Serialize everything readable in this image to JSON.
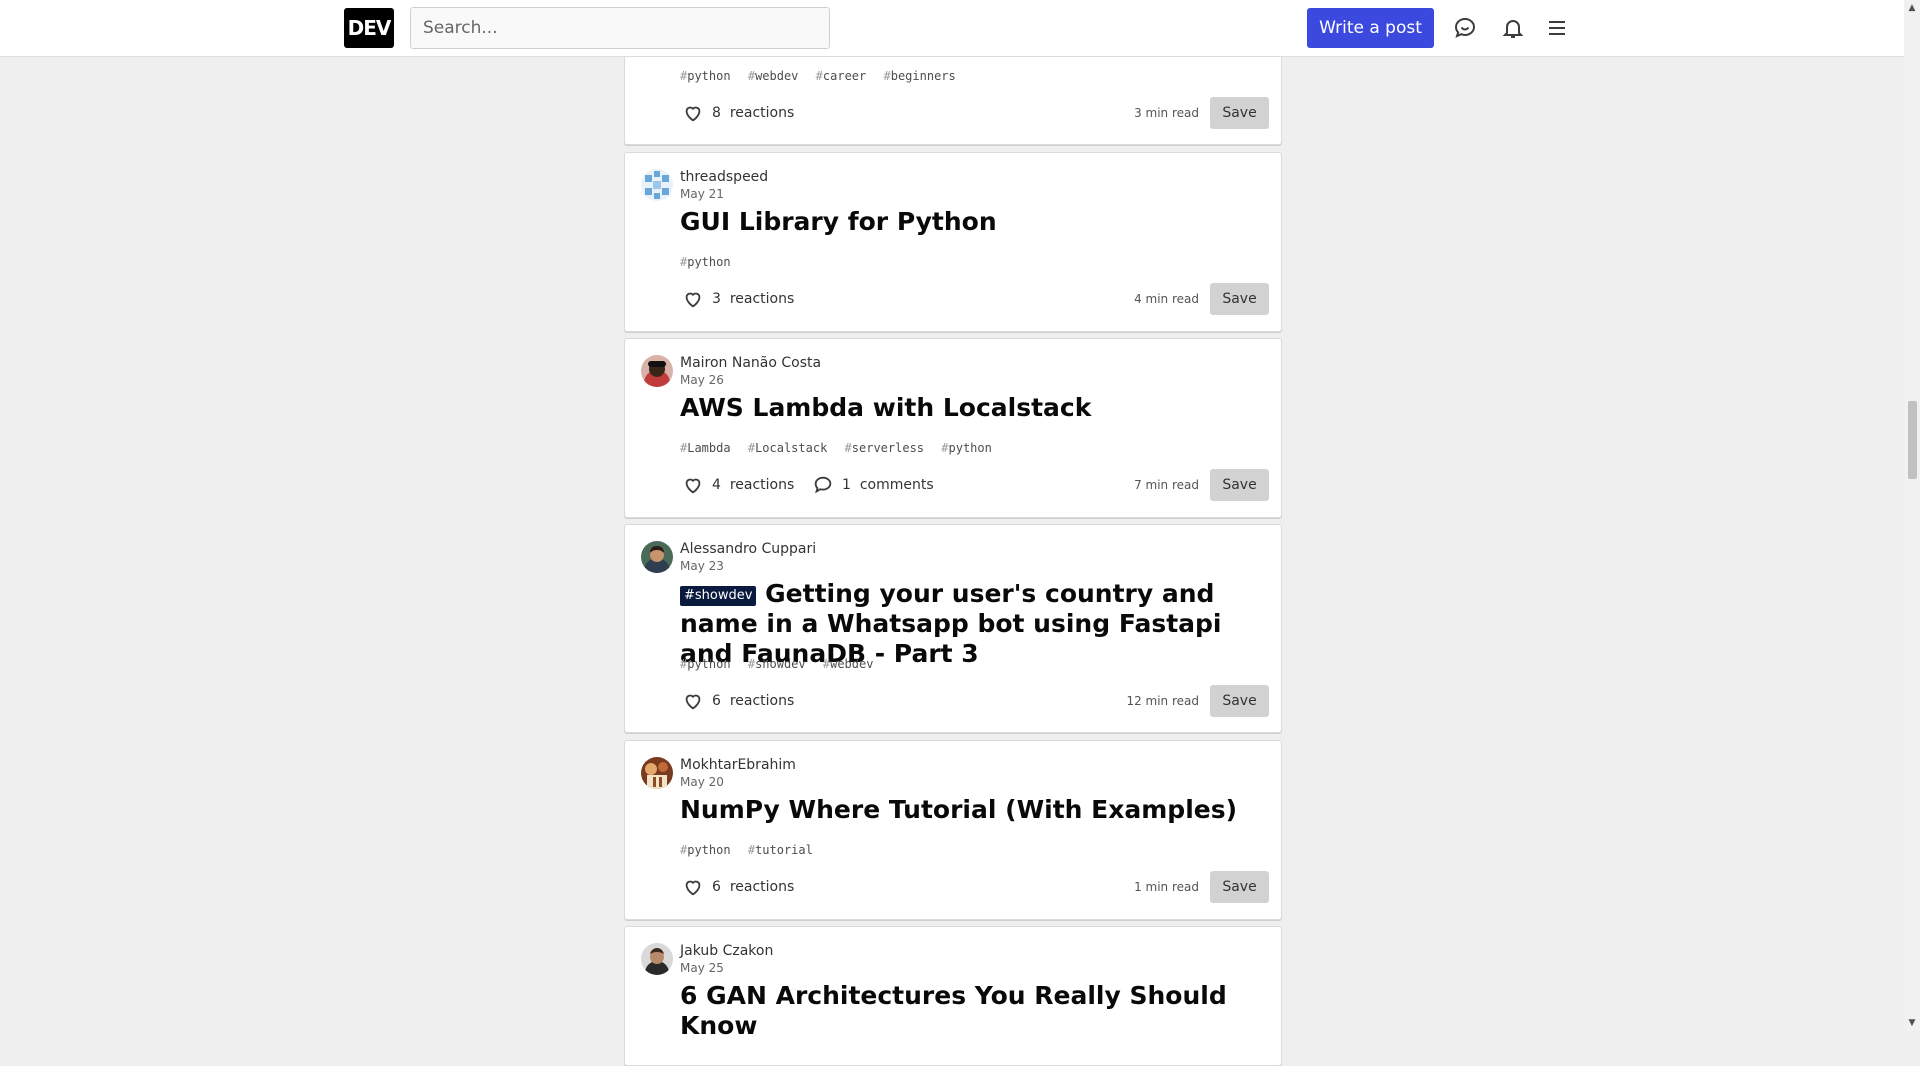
{
  "header": {
    "logo_text": "DEV",
    "search_placeholder": "Search...",
    "write_button": "Write a post",
    "icons": [
      "chat-icon",
      "bell-icon",
      "menu-icon"
    ]
  },
  "colors": {
    "accent": "#3b49df",
    "background": "#efefef",
    "save_button": "#d2d2d2",
    "flare_bg": "#0a1a3e"
  },
  "feed": {
    "posts": [
      {
        "author": "",
        "date": "",
        "title": "",
        "tags": [
          "python",
          "webdev",
          "career",
          "beginners"
        ],
        "reactions": "8",
        "reactions_label": "reactions",
        "read_time": "3 min read",
        "save_label": "Save"
      },
      {
        "author": "threadspeed",
        "date": "May 21",
        "title": "GUI Library for Python",
        "tags": [
          "python"
        ],
        "reactions": "3",
        "reactions_label": "reactions",
        "read_time": "4 min read",
        "save_label": "Save"
      },
      {
        "author": "Mairon Nanão Costa",
        "date": "May 26",
        "title": "AWS Lambda with Localstack",
        "tags": [
          "Lambda",
          "Localstack",
          "serverless",
          "python"
        ],
        "reactions": "4",
        "reactions_label": "reactions",
        "comments": "1",
        "comments_label": "comments",
        "read_time": "7 min read",
        "save_label": "Save"
      },
      {
        "author": "Alessandro Cuppari",
        "date": "May 23",
        "flare": "#showdev",
        "title": "Getting your user's country and name in a Whatsapp bot using Fastapi and FaunaDB - Part 3",
        "tags": [
          "python",
          "showdev",
          "webdev"
        ],
        "reactions": "6",
        "reactions_label": "reactions",
        "read_time": "12 min read",
        "save_label": "Save"
      },
      {
        "author": "MokhtarEbrahim",
        "date": "May 20",
        "title": "NumPy Where Tutorial (With Examples)",
        "tags": [
          "python",
          "tutorial"
        ],
        "reactions": "6",
        "reactions_label": "reactions",
        "read_time": "1 min read",
        "save_label": "Save"
      },
      {
        "author": "Jakub Czakon",
        "date": "May 25",
        "title": "6 GAN Architectures You Really Should Know"
      }
    ]
  }
}
